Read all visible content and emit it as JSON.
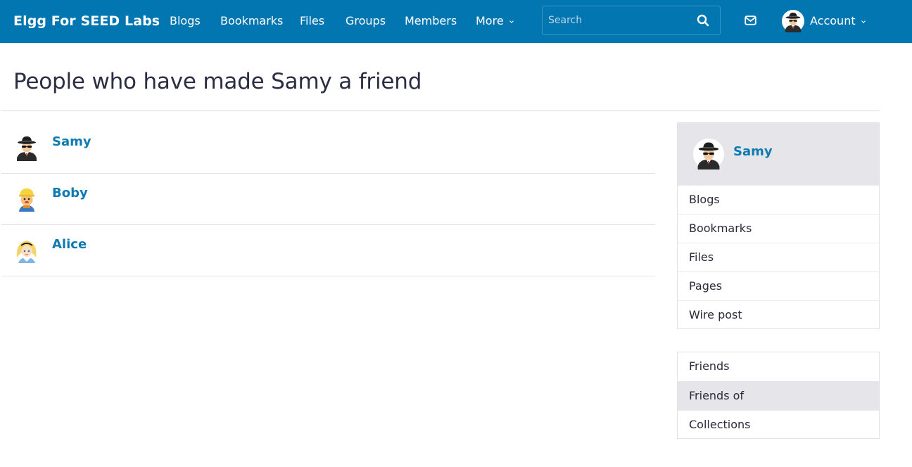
{
  "brand": {
    "title": "Elgg For SEED Labs"
  },
  "nav": {
    "items": [
      "Blogs",
      "Bookmarks",
      "Files",
      "Groups",
      "Members"
    ],
    "more_label": "More"
  },
  "search": {
    "placeholder": "Search"
  },
  "account": {
    "label": "Account"
  },
  "page": {
    "title": "People who have made Samy a friend"
  },
  "friends": [
    {
      "name": "Samy",
      "avatar": "spy-avatar"
    },
    {
      "name": "Boby",
      "avatar": "builder-avatar"
    },
    {
      "name": "Alice",
      "avatar": "alice-avatar"
    }
  ],
  "owner": {
    "name": "Samy",
    "menu": [
      "Blogs",
      "Bookmarks",
      "Files",
      "Pages",
      "Wire post"
    ]
  },
  "friends_menu": {
    "items": [
      "Friends",
      "Friends of",
      "Collections"
    ],
    "active": "Friends of"
  },
  "colors": {
    "topbar": "#0176b1",
    "link": "#0f7ab2",
    "sidebar_head": "#e6e6ea"
  }
}
